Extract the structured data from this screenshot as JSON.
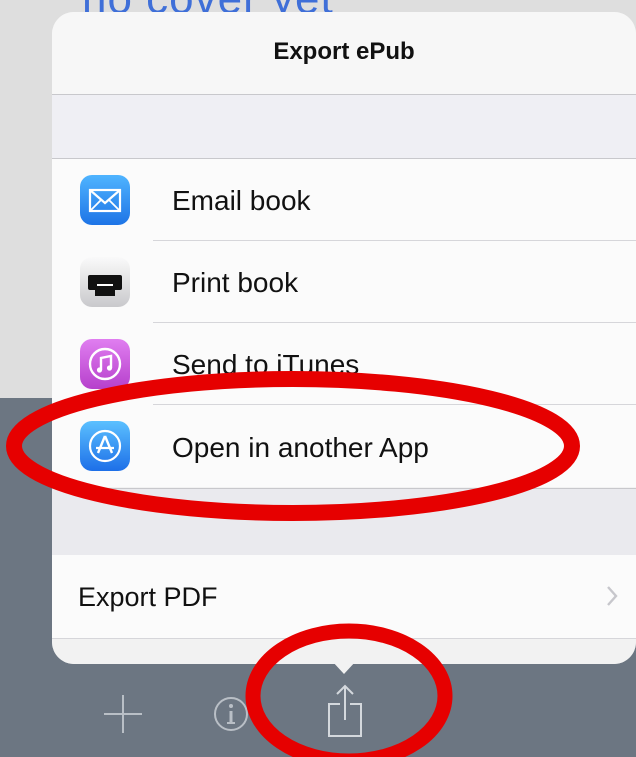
{
  "background": {
    "peek_text": "no cover yet"
  },
  "popover": {
    "title": "Export ePub",
    "items": [
      {
        "label": "Email book",
        "icon": "mail-icon"
      },
      {
        "label": "Print book",
        "icon": "printer-icon"
      },
      {
        "label": "Send to iTunes",
        "icon": "itunes-icon"
      },
      {
        "label": "Open in another App",
        "icon": "app-store-icon"
      }
    ],
    "export_pdf": {
      "label": "Export PDF"
    }
  },
  "toolbar": {
    "buttons": [
      {
        "icon": "plus-icon"
      },
      {
        "icon": "info-icon"
      },
      {
        "icon": "share-icon"
      }
    ]
  },
  "colors": {
    "popover_bg": "#f2f2f2",
    "toolbar_bg": "#6c7682",
    "annotation_red": "#e60000",
    "mail_icon": "#2a8cf0",
    "itunes_icon": "#c94fd6",
    "app_store_icon": "#2f86f0"
  }
}
